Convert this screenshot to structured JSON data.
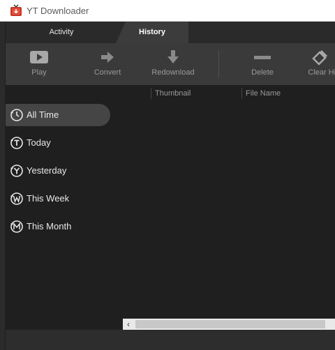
{
  "window": {
    "title": "YT Downloader",
    "logo_icon": "tv-downloader-logo",
    "logo_color": "#c0392b"
  },
  "tabs": [
    {
      "label": "Activity",
      "active": false
    },
    {
      "label": "History",
      "active": true
    }
  ],
  "toolbar": {
    "play": {
      "label": "Play",
      "icon": "play-icon"
    },
    "convert": {
      "label": "Convert",
      "icon": "arrow-right-icon"
    },
    "redownload": {
      "label": "Redownload",
      "icon": "arrow-down-icon"
    },
    "delete": {
      "label": "Delete",
      "icon": "minus-icon"
    },
    "clear_history": {
      "label": "Clear His",
      "icon": "eraser-icon"
    }
  },
  "sidebar": {
    "items": [
      {
        "label": "All Time",
        "icon": "clock-icon",
        "active": true
      },
      {
        "label": "Today",
        "icon": "clock-t-icon",
        "active": false
      },
      {
        "label": "Yesterday",
        "icon": "clock-y-icon",
        "active": false
      },
      {
        "label": "This Week",
        "icon": "clock-w-icon",
        "active": false
      },
      {
        "label": "This Month",
        "icon": "clock-m-icon",
        "active": false
      }
    ]
  },
  "table": {
    "columns": [
      "Thumbnail",
      "File Name"
    ],
    "rows": []
  },
  "scrollbar": {
    "left_arrow": "‹"
  }
}
